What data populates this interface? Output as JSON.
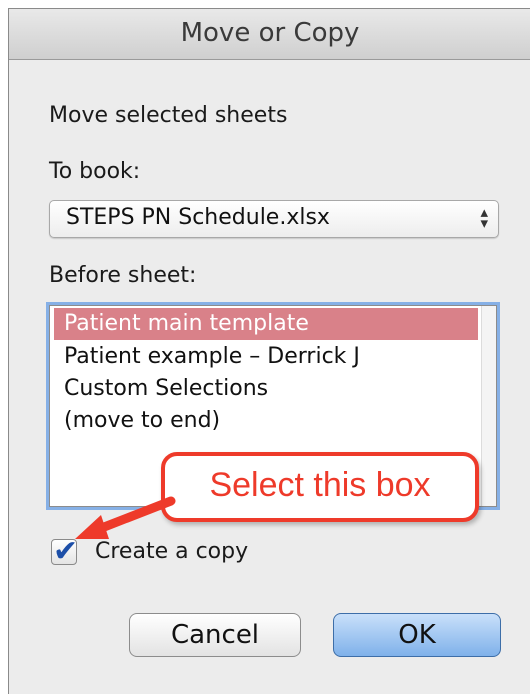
{
  "window": {
    "title": "Move or Copy"
  },
  "dialog": {
    "heading": "Move selected sheets",
    "to_book_label": "To book:",
    "to_book_value": "STEPS PN Schedule.xlsx",
    "before_sheet_label": "Before sheet:",
    "sheets": [
      "Patient main template",
      "Patient example – Derrick J",
      "Custom Selections",
      "(move to end)"
    ],
    "selected_sheet": "Patient main template",
    "create_copy_label": "Create a copy",
    "create_copy_checked": true,
    "cancel_label": "Cancel",
    "ok_label": "OK"
  },
  "annotation": {
    "callout_text": "Select this box",
    "color": "#ee3a2a"
  },
  "colors": {
    "selection": "#d98189",
    "default_button": "#7fb1ea",
    "focus_ring": "#86b0e6"
  }
}
